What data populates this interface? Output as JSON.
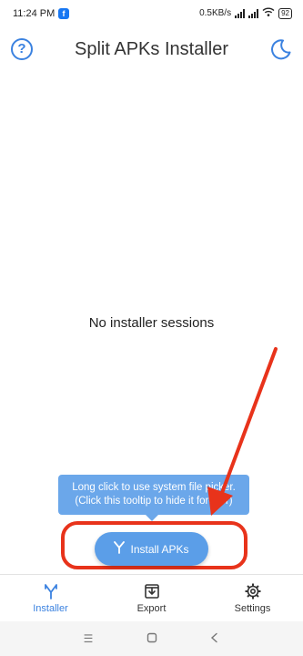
{
  "status_bar": {
    "time": "11:24 PM",
    "speed": "0.5KB/s",
    "battery": "92"
  },
  "app_bar": {
    "title": "Split APKs Installer",
    "help_icon": "help-circle-icon",
    "theme_icon": "moon-icon"
  },
  "main": {
    "empty_text": "No installer sessions"
  },
  "tooltip": {
    "line1": "Long click to use system file picker.",
    "line2": "(Click this tooltip to hide it forever)"
  },
  "install_button": {
    "label": "Install APKs",
    "icon": "split-icon"
  },
  "bottom_nav": {
    "items": [
      {
        "label": "Installer",
        "icon": "split-icon",
        "active": true
      },
      {
        "label": "Export",
        "icon": "export-icon",
        "active": false
      },
      {
        "label": "Settings",
        "icon": "gear-icon",
        "active": false
      }
    ]
  },
  "colors": {
    "accent": "#3b82e0",
    "button": "#5b9ee8",
    "tooltip": "#6ba7ea",
    "annotation": "#e8331b"
  }
}
